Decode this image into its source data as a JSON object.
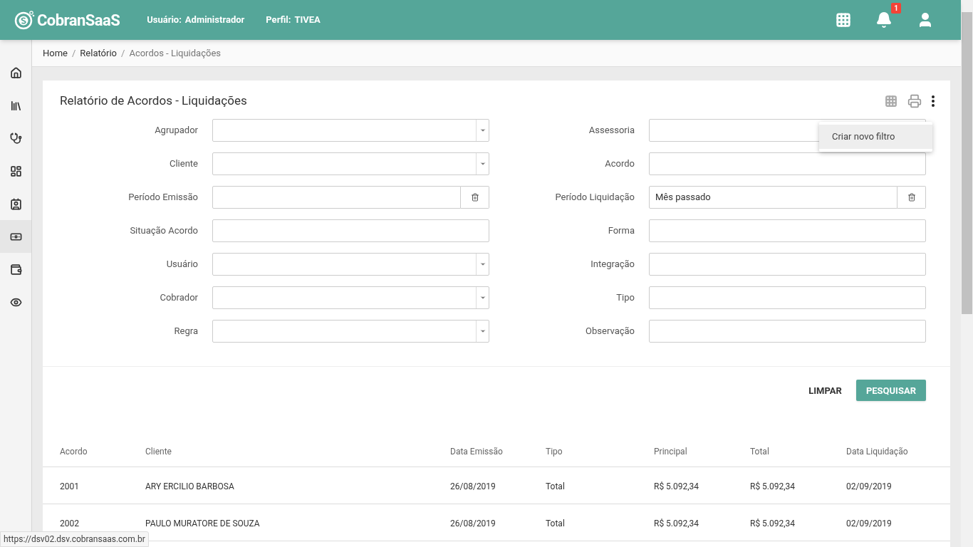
{
  "header": {
    "logo": "CobranSaaS",
    "user_label": "Usuário:",
    "user_value": "Administrador",
    "profile_label": "Perfil:",
    "profile_value": "TIVEA",
    "notification_count": "1"
  },
  "sidebar": {
    "items": [
      {
        "selected": false
      },
      {
        "selected": false
      },
      {
        "selected": false
      },
      {
        "selected": false
      },
      {
        "selected": false
      },
      {
        "selected": true
      },
      {
        "selected": false
      },
      {
        "selected": false
      }
    ]
  },
  "breadcrumb": [
    {
      "kind": "link",
      "text": "Home"
    },
    {
      "kind": "separator",
      "text": "/"
    },
    {
      "kind": "link",
      "text": "Relatório"
    },
    {
      "kind": "separator",
      "text": "/"
    },
    {
      "kind": "current",
      "text": "Acordos - Liquidações"
    }
  ],
  "card": {
    "title": "Relatório de Acordos - Liquidações",
    "menu": {
      "items": [
        "Criar novo filtro"
      ]
    },
    "filters_left": [
      {
        "label": "Agrupador",
        "kind": "select"
      },
      {
        "label": "Cliente",
        "kind": "select"
      },
      {
        "label": "Período Emissão",
        "kind": "date"
      },
      {
        "label": "Situação Acordo",
        "kind": "text"
      },
      {
        "label": "Usuário",
        "kind": "select"
      },
      {
        "label": "Cobrador",
        "kind": "select"
      },
      {
        "label": "Regra",
        "kind": "select"
      }
    ],
    "filters_right": [
      {
        "label": "Assessoria",
        "kind": "text"
      },
      {
        "label": "Acordo",
        "kind": "text"
      },
      {
        "label": "Período Liquidação",
        "kind": "date",
        "value": "Mês passado"
      },
      {
        "label": "Forma",
        "kind": "text"
      },
      {
        "label": "Integração",
        "kind": "text"
      },
      {
        "label": "Tipo",
        "kind": "text"
      },
      {
        "label": "Observação",
        "kind": "text"
      }
    ],
    "buttons": {
      "clear": "LIMPAR",
      "search": "PESQUISAR"
    }
  },
  "table": {
    "columns": [
      "Acordo",
      "Cliente",
      "Data Emissão",
      "Tipo",
      "Principal",
      "Total",
      "Data Liquidação"
    ],
    "rows": [
      [
        "2001",
        "ARY ERCILIO BARBOSA",
        "26/08/2019",
        "Total",
        "R$ 5.092,34",
        "R$ 5.092,34",
        "02/09/2019"
      ],
      [
        "2002",
        "PAULO MURATORE DE SOUZA",
        "26/08/2019",
        "Total",
        "R$ 5.092,34",
        "R$ 5.092,34",
        "02/09/2019"
      ]
    ]
  },
  "status_bar": {
    "url": "https://dsv02.dsv.cobransaas.com.br"
  }
}
